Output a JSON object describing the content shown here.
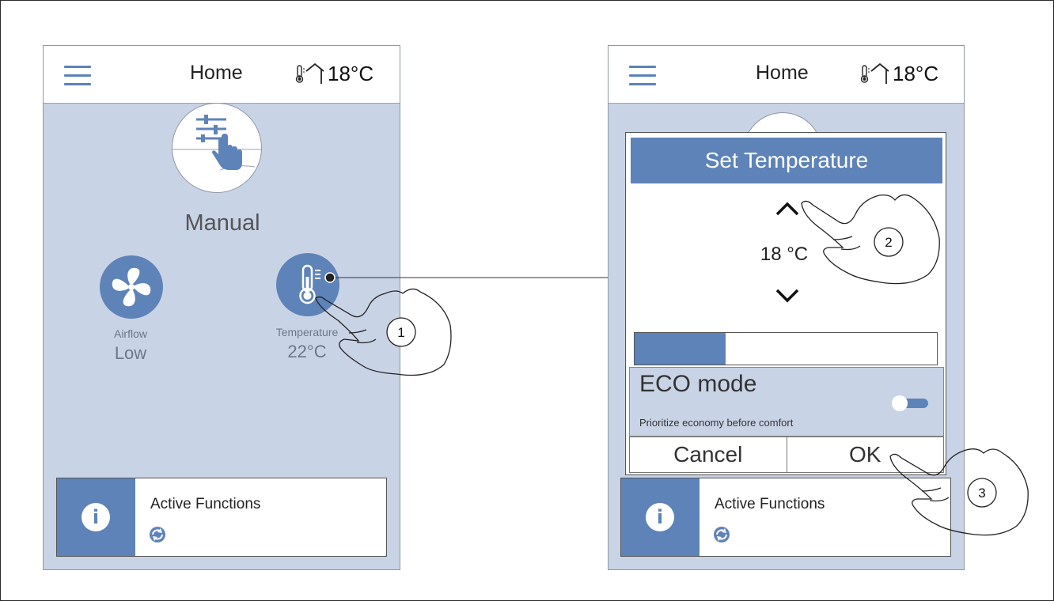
{
  "left_screen": {
    "header": {
      "menu_icon": "hamburger-menu-icon",
      "title": "Home",
      "climate_icon": "thermometer-house-icon",
      "temperature": "18°C"
    },
    "mode": {
      "icon": "manual-control-hand-icon",
      "label": "Manual"
    },
    "tiles": {
      "airflow": {
        "icon": "fan-icon",
        "caption": "Airflow",
        "value": "Low"
      },
      "temperature": {
        "icon": "thermometer-icon",
        "caption": "Temperature",
        "value": "22°C"
      }
    },
    "info_card": {
      "icon": "info-icon",
      "title": "Active Functions",
      "function_icon": "refresh-cycle-icon"
    }
  },
  "right_screen": {
    "header": {
      "menu_icon": "hamburger-menu-icon",
      "title": "Home",
      "climate_icon": "thermometer-house-icon",
      "temperature": "18°C"
    },
    "dialog": {
      "title": "Set Temperature",
      "temperature_value": "18 °C",
      "up_icon": "chevron-up-icon",
      "down_icon": "chevron-down-icon",
      "level": 0.3,
      "eco": {
        "title": "ECO mode",
        "description": "Prioritize economy before comfort",
        "enabled": false
      },
      "cancel_label": "Cancel",
      "ok_label": "OK"
    },
    "info_card": {
      "icon": "info-icon",
      "title": "Active Functions",
      "function_icon": "refresh-cycle-icon"
    }
  },
  "annotations": {
    "steps": [
      "1",
      "2",
      "3"
    ]
  },
  "colors": {
    "accent": "#5e83b8",
    "screen_bg": "#c9d3e6",
    "white": "#ffffff",
    "text": "#222222"
  }
}
